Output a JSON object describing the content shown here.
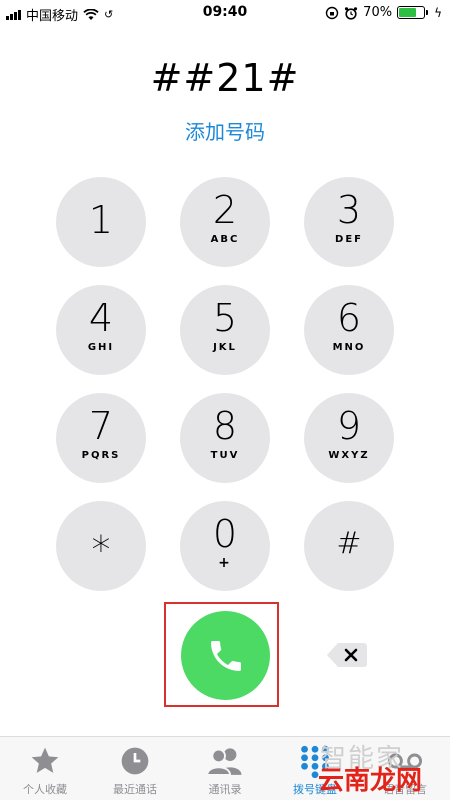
{
  "status_bar": {
    "carrier": "中国移动",
    "time": "09:40",
    "battery": "70%",
    "battery_level": 0.7
  },
  "dialer": {
    "number": "##21#",
    "add_number_label": "添加号码"
  },
  "keypad": {
    "keys": [
      {
        "digit": "1",
        "letters": ""
      },
      {
        "digit": "2",
        "letters": "ABC"
      },
      {
        "digit": "3",
        "letters": "DEF"
      },
      {
        "digit": "4",
        "letters": "GHI"
      },
      {
        "digit": "5",
        "letters": "JKL"
      },
      {
        "digit": "6",
        "letters": "MNO"
      },
      {
        "digit": "7",
        "letters": "PQRS"
      },
      {
        "digit": "8",
        "letters": "TUV"
      },
      {
        "digit": "9",
        "letters": "WXYZ"
      },
      {
        "digit": "*",
        "letters": ""
      },
      {
        "digit": "0",
        "letters": "+"
      },
      {
        "digit": "#",
        "letters": ""
      }
    ]
  },
  "actions": {
    "call_icon": "phone-icon",
    "delete_icon": "backspace-icon"
  },
  "tab_bar": {
    "items": [
      {
        "label": "个人收藏",
        "icon": "star-icon"
      },
      {
        "label": "最近通话",
        "icon": "clock-icon"
      },
      {
        "label": "通讯录",
        "icon": "contacts-icon"
      },
      {
        "label": "拨号键盘",
        "icon": "keypad-icon",
        "active": true
      },
      {
        "label": "语音留言",
        "icon": "voicemail-icon"
      }
    ]
  },
  "watermark": {
    "cn_text": "智能家",
    "brand_text": "云南龙网"
  },
  "colors": {
    "accent": "#1e88d6",
    "call_green": "#4cd964",
    "key_gray": "#e5e5e7",
    "highlight_red": "#d8332a"
  }
}
